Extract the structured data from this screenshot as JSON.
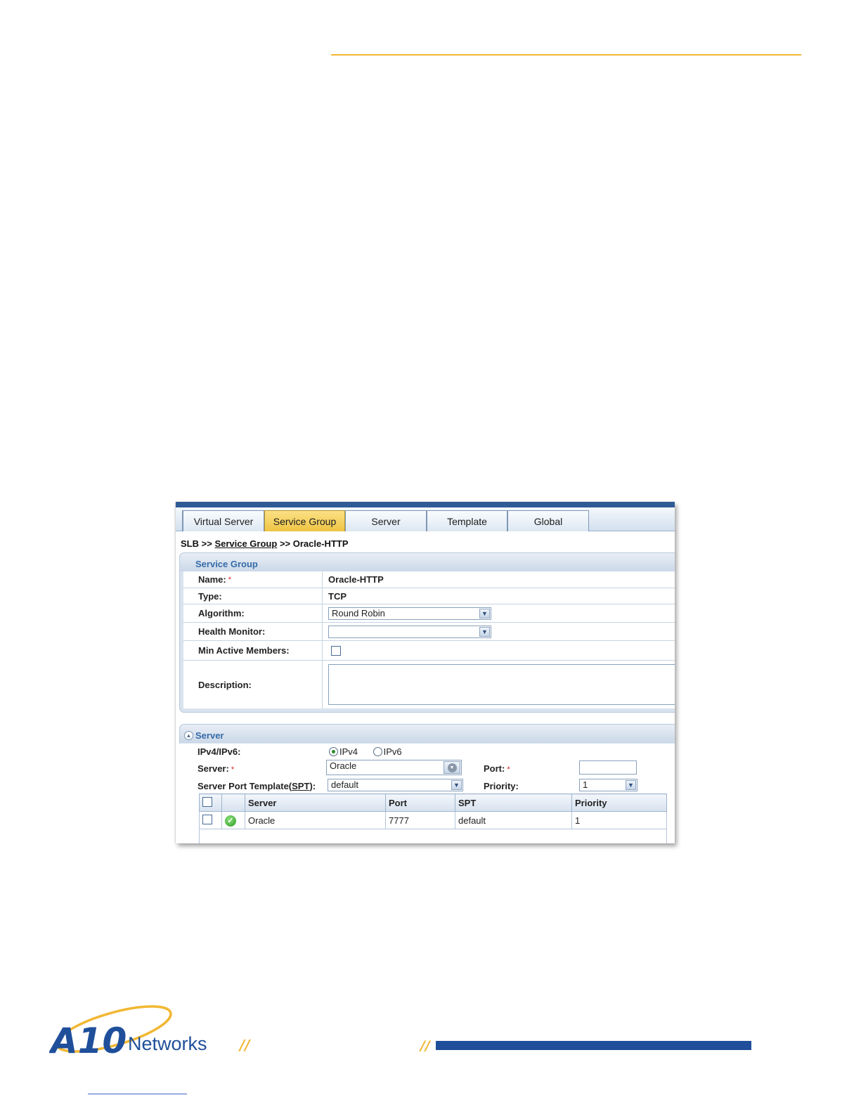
{
  "tabs": [
    {
      "label": "Virtual Server",
      "active": false
    },
    {
      "label": "Service Group",
      "active": true
    },
    {
      "label": "Server",
      "active": false
    },
    {
      "label": "Template",
      "active": false
    },
    {
      "label": "Global",
      "active": false
    }
  ],
  "breadcrumb": {
    "root": "SLB",
    "sep1": ">>",
    "link": "Service Group",
    "sep2": ">>",
    "current": "Oracle-HTTP"
  },
  "service_group": {
    "title": "Service Group",
    "name_label": "Name:",
    "name_value": "Oracle-HTTP",
    "type_label": "Type:",
    "type_value": "TCP",
    "algorithm_label": "Algorithm:",
    "algorithm_value": "Round Robin",
    "health_label": "Health Monitor:",
    "health_value": "",
    "min_active_label": "Min Active Members:",
    "description_label": "Description:"
  },
  "server_section": {
    "title": "Server",
    "ipver_label": "IPv4/IPv6:",
    "ipv4": "IPv4",
    "ipv6": "IPv6",
    "server_label": "Server:",
    "server_value": "Oracle",
    "port_label": "Port:",
    "port_value": "",
    "spt_label_prefix": "Server Port Template(",
    "spt_label_link": "SPT",
    "spt_label_suffix": "):",
    "spt_value": "default",
    "priority_label": "Priority:",
    "priority_value": "1"
  },
  "grid": {
    "headers": [
      "Server",
      "Port",
      "SPT",
      "Priority"
    ],
    "rows": [
      {
        "server": "Oracle",
        "port": "7777",
        "spt": "default",
        "priority": "1"
      }
    ]
  },
  "footer": {
    "brand_a10": "A10",
    "brand_networks": "Networks",
    "slashes": "//"
  },
  "colors": {
    "accent_gold": "#f2b733",
    "brand_blue": "#1f4f9a",
    "tab_active": "#efc443"
  }
}
